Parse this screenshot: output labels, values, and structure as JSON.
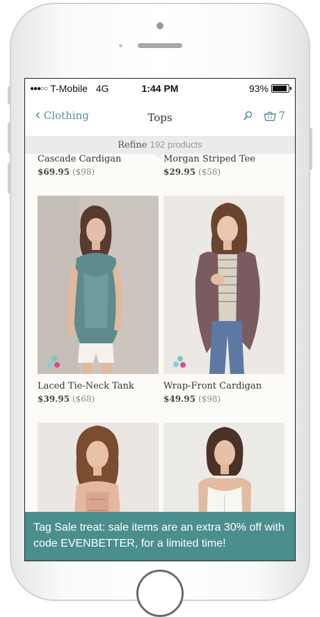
{
  "status": {
    "carrier": "T-Mobile",
    "network": "4G",
    "time": "1:44 PM",
    "battery": "93%"
  },
  "nav": {
    "back_label": "Clothing",
    "title": "Tops",
    "cart_count": "7"
  },
  "refine": {
    "label": "Refine",
    "count": "192 products"
  },
  "products": [
    {
      "name": "Cascade Cardigan",
      "price": "$69.95",
      "original": "($98)"
    },
    {
      "name": "Morgan Striped Tee",
      "price": "$29.95",
      "original": "($58)"
    },
    {
      "name": "Laced Tie-Neck Tank",
      "price": "$39.95",
      "original": "($68)"
    },
    {
      "name": "Wrap-Front Cardigan",
      "price": "$49.95",
      "original": "($98)"
    }
  ],
  "promo": {
    "text": "Tag Sale treat: sale items are an extra 30% off with code EVENBETTER, for a limited time!"
  },
  "colors": {
    "accent": "#5a8d98",
    "promo_bg": "#4b8e8e"
  }
}
